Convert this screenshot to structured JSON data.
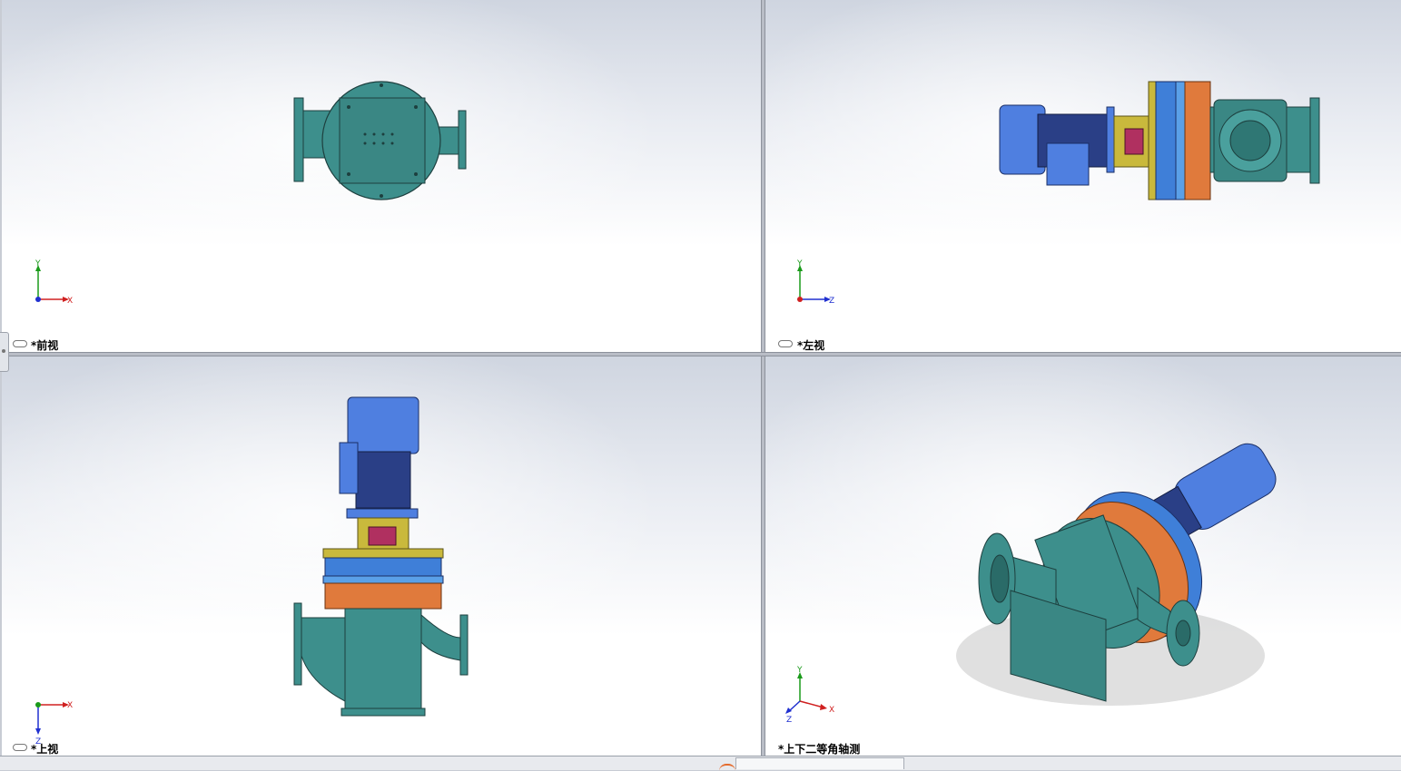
{
  "viewports": [
    {
      "id": "front",
      "label": "*前视",
      "axis_h": "X",
      "axis_v": "Y"
    },
    {
      "id": "left",
      "label": "*左视",
      "axis_h": "Z",
      "axis_v": "Y"
    },
    {
      "id": "top",
      "label": "*上视",
      "axis_h": "X",
      "axis_v": "Z"
    },
    {
      "id": "iso",
      "label": "*上下二等角轴测",
      "axis_h": "X",
      "axis_v": "Y",
      "axis_d": "Z"
    }
  ],
  "colors": {
    "pump_body": "#3d8f8c",
    "motor": "#4f7fe0",
    "flange_blue": "#3f7fd8",
    "flange_orange": "#e07a3c",
    "bracket_yellow": "#c9b93c",
    "coupling": "#b03060",
    "axis_x": "#d02020",
    "axis_y": "#1a9a1a",
    "axis_z": "#2030d0"
  }
}
